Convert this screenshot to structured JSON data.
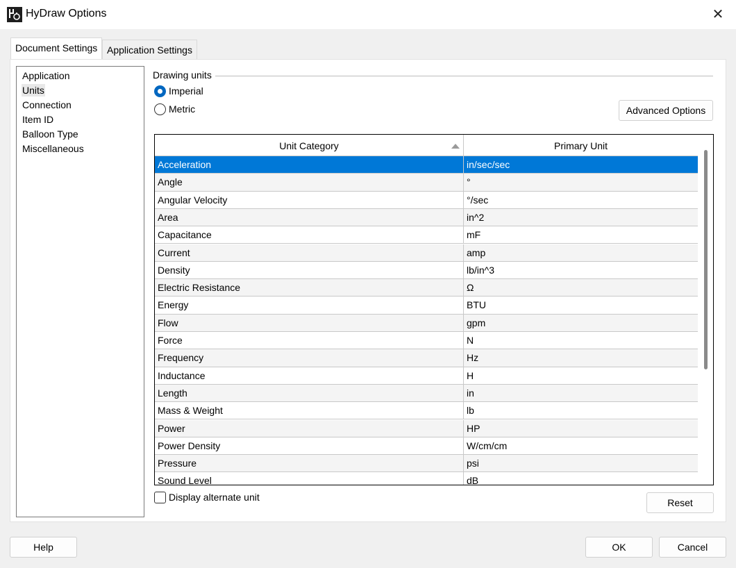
{
  "window": {
    "title": "HyDraw Options",
    "icon": "hydraw-app-icon",
    "close_symbol": "✕"
  },
  "tabs": [
    {
      "label": "Document Settings",
      "active": true
    },
    {
      "label": "Application Settings",
      "active": false
    }
  ],
  "nav": {
    "items": [
      {
        "label": "Application",
        "selected": false
      },
      {
        "label": "Units",
        "selected": true
      },
      {
        "label": "Connection",
        "selected": false
      },
      {
        "label": "Item ID",
        "selected": false
      },
      {
        "label": "Balloon Type",
        "selected": false
      },
      {
        "label": "Miscellaneous",
        "selected": false
      }
    ]
  },
  "units": {
    "group_label": "Drawing units",
    "options": [
      {
        "label": "Imperial",
        "checked": true
      },
      {
        "label": "Metric",
        "checked": false
      }
    ],
    "advanced_button": "Advanced Options"
  },
  "grid": {
    "columns": [
      "Unit Category",
      "Primary Unit"
    ],
    "sort_column": "Unit Category",
    "sort_direction": "ascending",
    "rows": [
      {
        "category": "Acceleration",
        "unit": "in/sec/sec",
        "selected": true
      },
      {
        "category": "Angle",
        "unit": "°"
      },
      {
        "category": "Angular Velocity",
        "unit": "°/sec"
      },
      {
        "category": "Area",
        "unit": "in^2"
      },
      {
        "category": "Capacitance",
        "unit": "mF"
      },
      {
        "category": "Current",
        "unit": "amp"
      },
      {
        "category": "Density",
        "unit": "lb/in^3"
      },
      {
        "category": "Electric Resistance",
        "unit": "Ω"
      },
      {
        "category": "Energy",
        "unit": "BTU"
      },
      {
        "category": "Flow",
        "unit": "gpm"
      },
      {
        "category": "Force",
        "unit": "N"
      },
      {
        "category": "Frequency",
        "unit": "Hz"
      },
      {
        "category": "Inductance",
        "unit": "H"
      },
      {
        "category": "Length",
        "unit": "in"
      },
      {
        "category": "Mass & Weight",
        "unit": "lb"
      },
      {
        "category": "Power",
        "unit": "HP"
      },
      {
        "category": "Power Density",
        "unit": "W/cm/cm"
      },
      {
        "category": "Pressure",
        "unit": "psi"
      },
      {
        "category": "Sound Level",
        "unit": "dB"
      }
    ]
  },
  "display_alternate": {
    "label": "Display alternate unit",
    "checked": false
  },
  "buttons": {
    "reset": "Reset",
    "help": "Help",
    "ok": "OK",
    "cancel": "Cancel"
  },
  "colors": {
    "selection": "#0078d7",
    "radio_accent": "#0067c0"
  }
}
